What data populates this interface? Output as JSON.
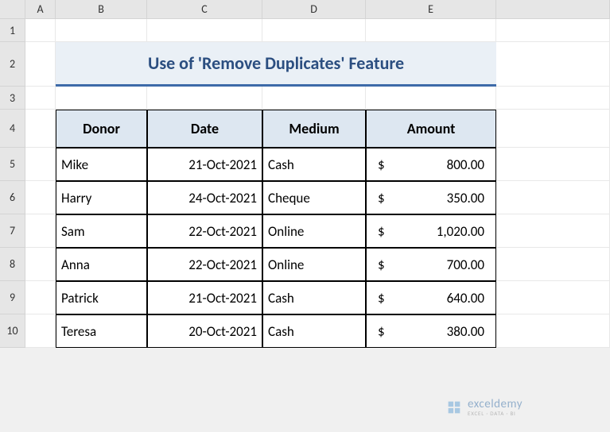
{
  "columns": [
    "A",
    "B",
    "C",
    "D",
    "E"
  ],
  "rows": [
    "1",
    "2",
    "3",
    "4",
    "5",
    "6",
    "7",
    "8",
    "9",
    "10"
  ],
  "title": "Use of 'Remove Duplicates' Feature",
  "headers": {
    "donor": "Donor",
    "date": "Date",
    "medium": "Medium",
    "amount": "Amount"
  },
  "data": [
    {
      "donor": "Mike",
      "date": "21-Oct-2021",
      "medium": "Cash",
      "currency": "$",
      "amount": "800.00"
    },
    {
      "donor": "Harry",
      "date": "24-Oct-2021",
      "medium": "Cheque",
      "currency": "$",
      "amount": "350.00"
    },
    {
      "donor": "Sam",
      "date": "22-Oct-2021",
      "medium": "Online",
      "currency": "$",
      "amount": "1,020.00"
    },
    {
      "donor": "Anna",
      "date": "22-Oct-2021",
      "medium": "Online",
      "currency": "$",
      "amount": "700.00"
    },
    {
      "donor": "Patrick",
      "date": "21-Oct-2021",
      "medium": "Cash",
      "currency": "$",
      "amount": "640.00"
    },
    {
      "donor": "Teresa",
      "date": "20-Oct-2021",
      "medium": "Cash",
      "currency": "$",
      "amount": "380.00"
    }
  ],
  "watermark": {
    "brand": "exceldemy",
    "sub": "EXCEL · DATA · BI"
  }
}
